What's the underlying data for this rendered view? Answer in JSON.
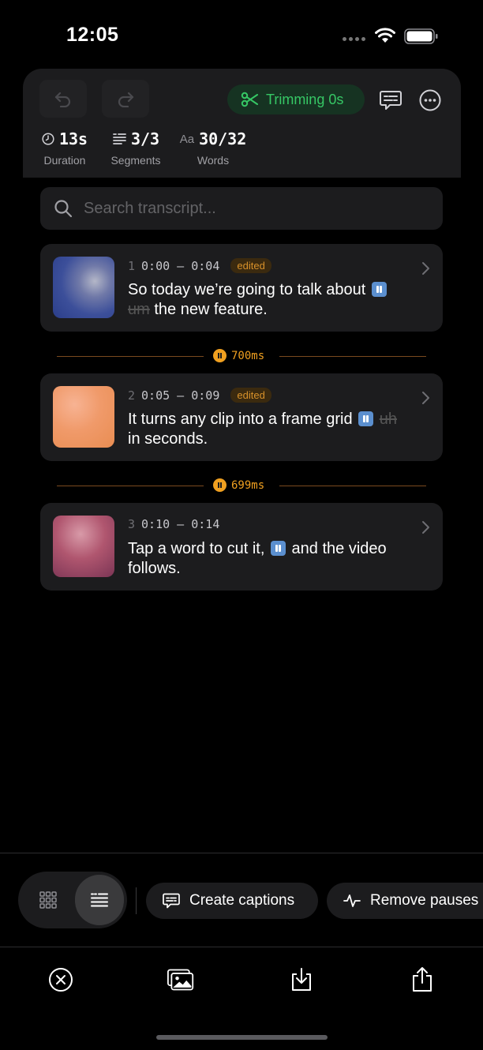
{
  "status_bar": {
    "time": "12:05"
  },
  "header": {
    "trim_label": "Trimming 0s",
    "stats": {
      "duration": {
        "value": "13s",
        "label": "Duration"
      },
      "segments": {
        "value": "3/3",
        "label": "Segments"
      },
      "words": {
        "prefix": "Aa",
        "value": "30/32",
        "label": "Words"
      }
    }
  },
  "search": {
    "placeholder": "Search transcript..."
  },
  "segments": [
    {
      "index": "1",
      "time": "0:00 – 0:04",
      "badge": "edited",
      "text_before": "So today we’re going to talk about",
      "struck": "um",
      "text_after": "the new feature."
    },
    {
      "index": "2",
      "time": "0:05 – 0:09",
      "badge": "edited",
      "text_before": "It turns any clip into a frame grid",
      "struck": "uh",
      "text_after": "in seconds."
    },
    {
      "index": "3",
      "time": "0:10 – 0:14",
      "badge": "",
      "text_before": "Tap a word to cut it,",
      "struck": "",
      "text_after": "and the video follows."
    }
  ],
  "pauses": [
    {
      "label": "700ms"
    },
    {
      "label": "699ms"
    }
  ],
  "actions": {
    "create_captions": "Create captions",
    "remove_pauses": "Remove pauses"
  },
  "colors": {
    "accent_green": "#36c765",
    "pause_orange": "#f0a020",
    "edited_badge": "#d8912a",
    "card_bg": "#1c1c1e"
  }
}
